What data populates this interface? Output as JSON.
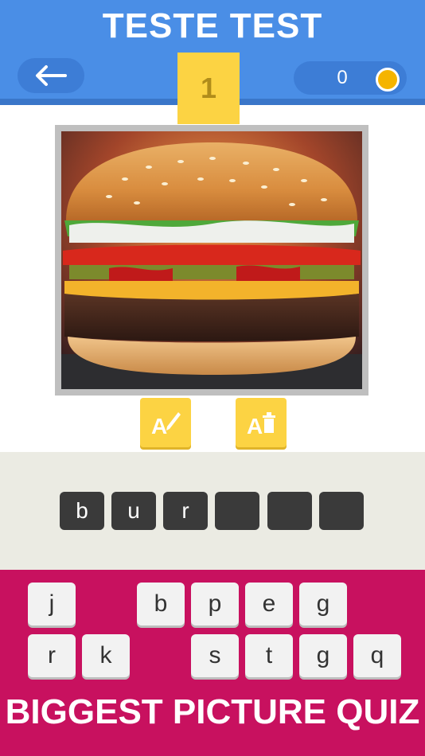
{
  "header": {
    "title": "TESTE TEST",
    "back_icon": "arrow-left-icon",
    "coins": "0",
    "coin_icon": "coin-icon"
  },
  "level": {
    "number": "1"
  },
  "picture": {
    "subject": "hamburger"
  },
  "hints": {
    "reveal_letter_icon": "pencil-letter-icon",
    "remove_letters_icon": "trash-letter-icon"
  },
  "answer": {
    "slots": [
      "b",
      "u",
      "r",
      "",
      "",
      ""
    ]
  },
  "keyboard": {
    "row1": [
      "j",
      "",
      "b",
      "p",
      "e",
      "g"
    ],
    "row2": [
      "r",
      "k",
      "",
      "s",
      "t",
      "g",
      "q"
    ]
  },
  "footer": {
    "title": "BIGGEST PICTURE QUIZ"
  },
  "colors": {
    "header": "#4a8ee6",
    "accent_yellow": "#fcd343",
    "keyboard_bg": "#c8115f",
    "slot": "#3a3a3a",
    "coin": "#f5b400"
  }
}
